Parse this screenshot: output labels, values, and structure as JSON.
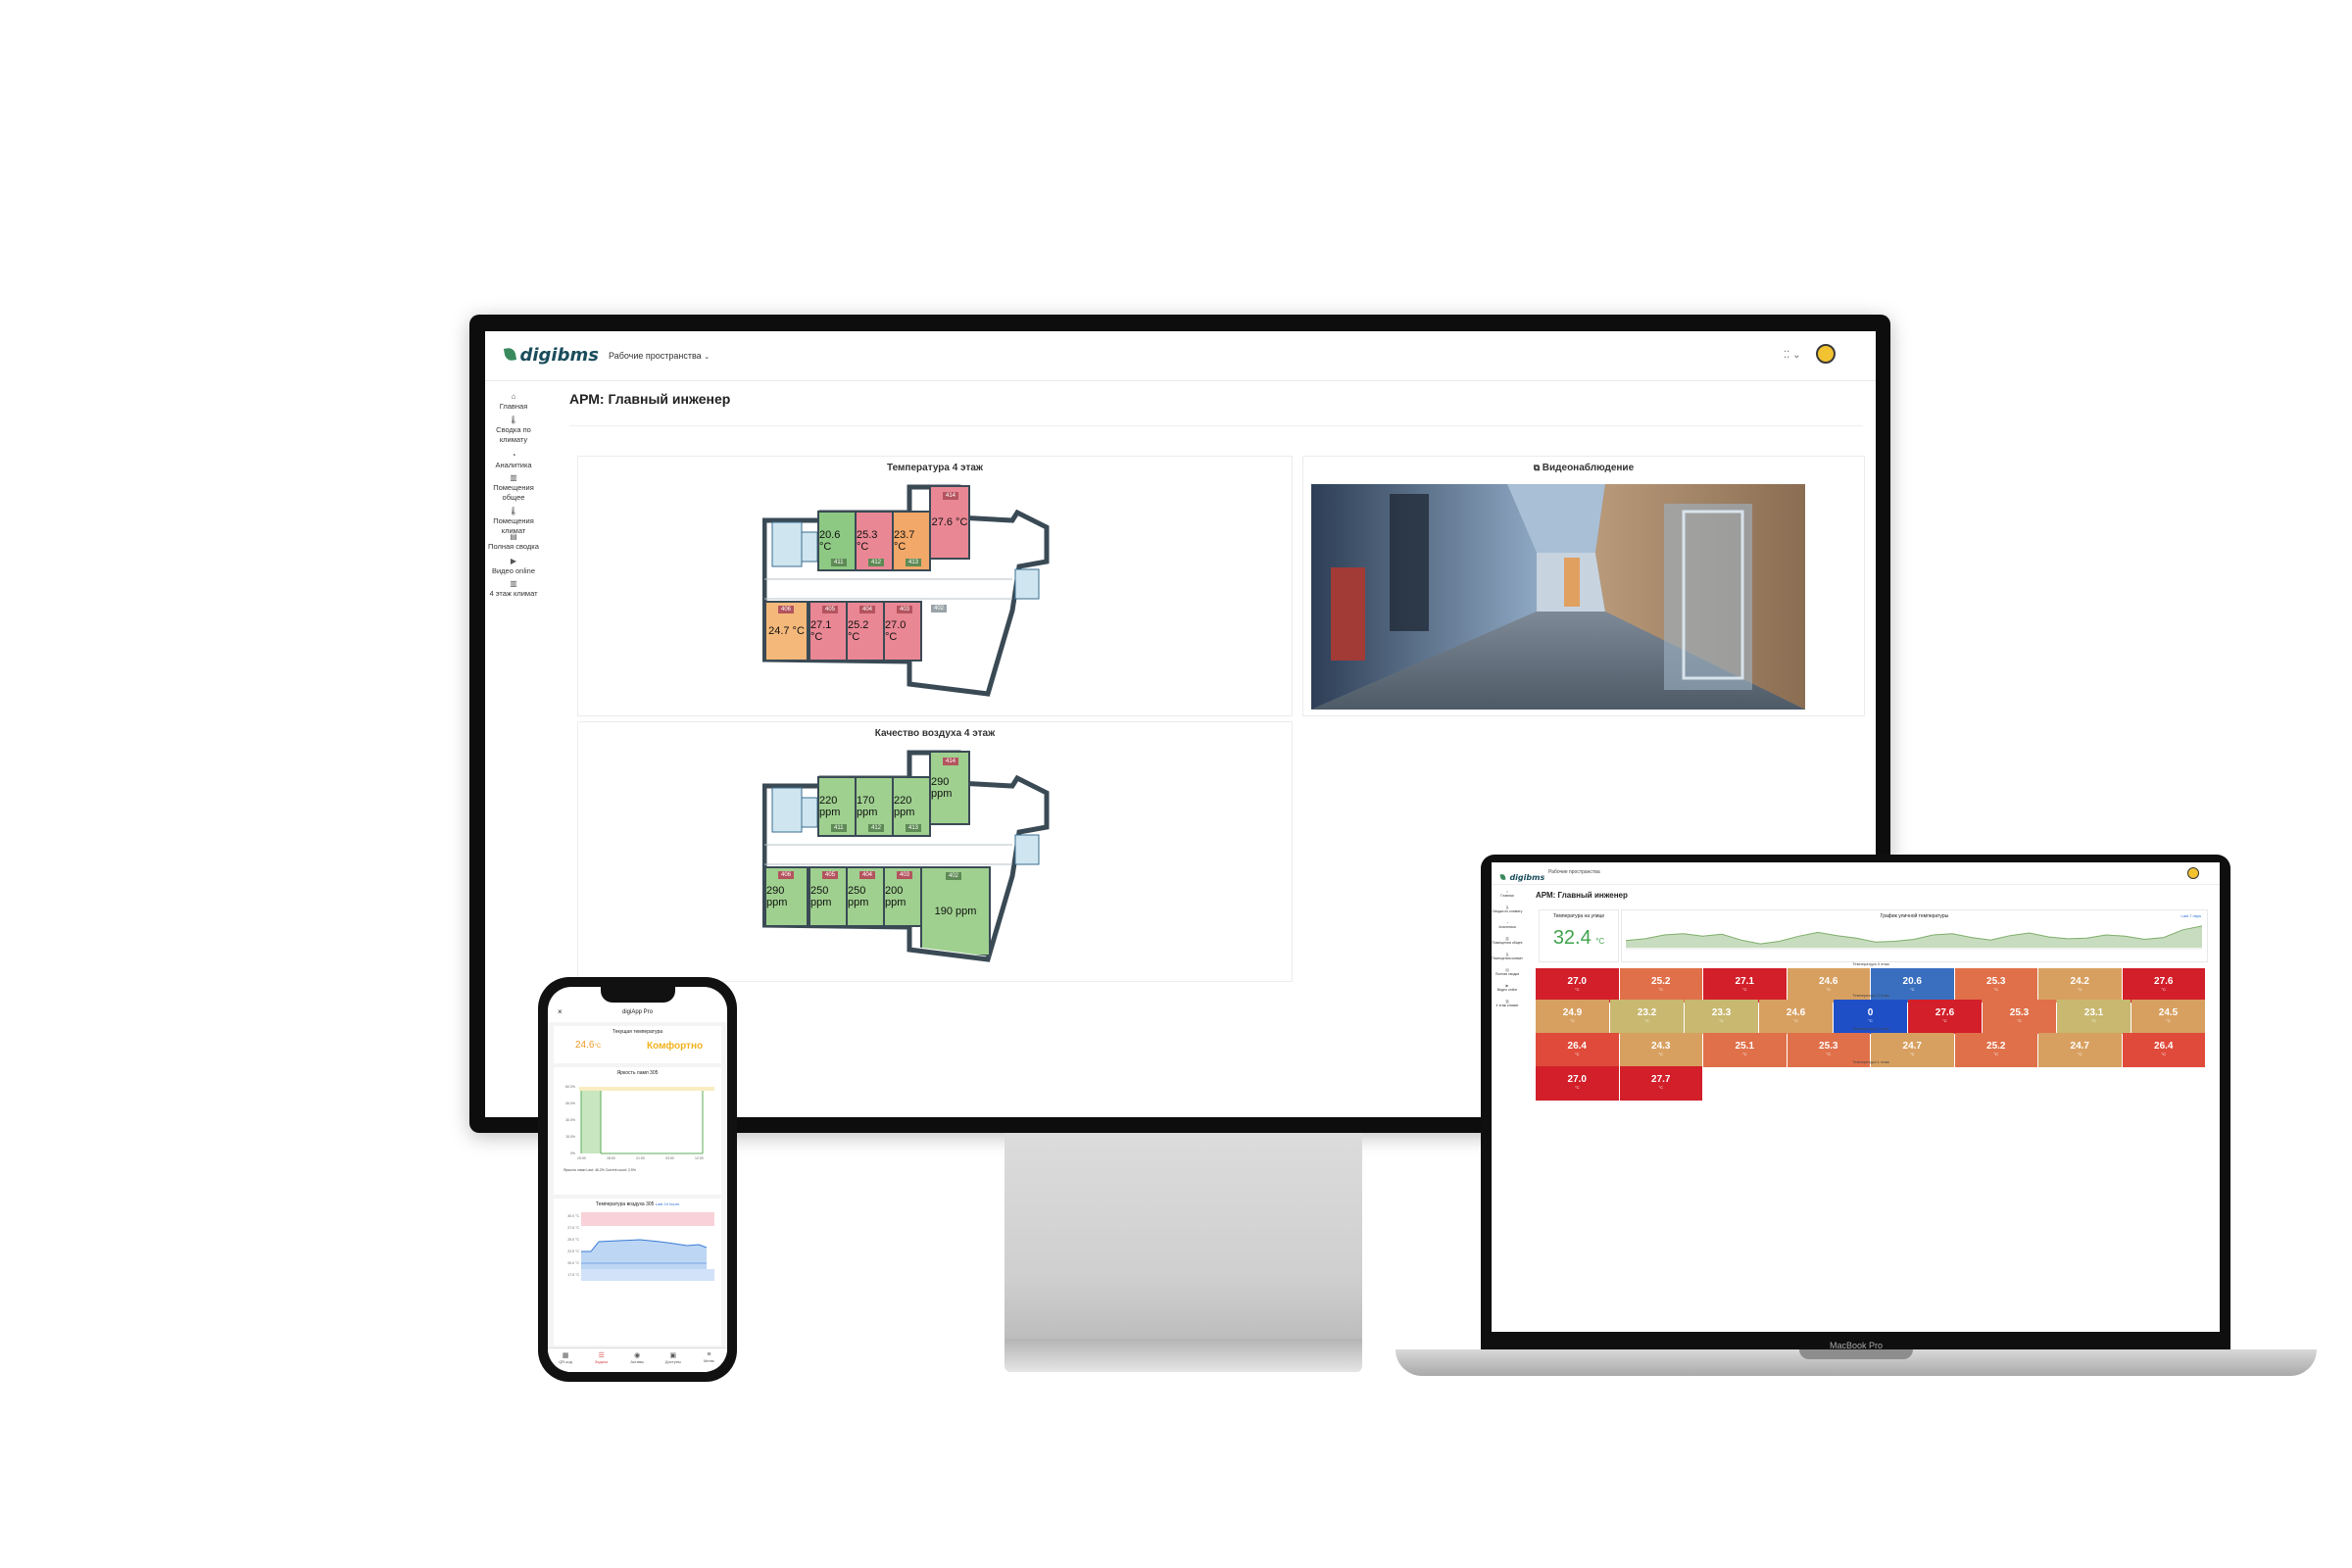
{
  "monitor": {
    "brand": "digibms",
    "workspace_menu": "Рабочие пространства",
    "page_title": "АРМ: Главный инженер",
    "sidebar": [
      {
        "label": "Главная",
        "icon": "home-icon"
      },
      {
        "label": "Сводка по климату",
        "icon": "thermometer-icon"
      },
      {
        "label": "Аналитика",
        "icon": "analytics-icon"
      },
      {
        "label": "Помещения общее",
        "icon": "building-icon"
      },
      {
        "label": "Помещения климат",
        "icon": "thermometer-icon"
      },
      {
        "label": "Полная сводка",
        "icon": "calendar-icon"
      },
      {
        "label": "Видео online",
        "icon": "video-icon"
      },
      {
        "label": "4 этаж климат",
        "icon": "building-icon"
      }
    ],
    "temp_panel": {
      "title": "Температура 4 этаж",
      "rooms_top": [
        {
          "tag": "411",
          "value": "20.6 °C",
          "color": "#8dc983"
        },
        {
          "tag": "412",
          "value": "25.3 °C",
          "color": "#ea8794"
        },
        {
          "tag": "413",
          "value": "23.7 °C",
          "color": "#f2a868"
        }
      ],
      "room_corner": {
        "tag": "414",
        "value": "27.6 °C",
        "color": "#ea8794"
      },
      "rooms_bottom": [
        {
          "tag": "406",
          "value": "24.7 °C",
          "color": "#f4b87a"
        },
        {
          "tag": "405",
          "value": "27.1 °C",
          "color": "#ea8794"
        },
        {
          "tag": "404",
          "value": "25.2 °C",
          "color": "#ea8794"
        },
        {
          "tag": "403",
          "value": "27.0 °C",
          "color": "#ea8794"
        }
      ],
      "corridor_tag": "402"
    },
    "air_panel": {
      "title": "Качество воздуха 4 этаж",
      "rooms_top": [
        {
          "tag": "411",
          "value": "220 ppm"
        },
        {
          "tag": "412",
          "value": "170 ppm"
        },
        {
          "tag": "413",
          "value": "220 ppm"
        }
      ],
      "room_corner": {
        "tag": "414",
        "value": "290 ppm"
      },
      "rooms_bottom": [
        {
          "tag": "406",
          "value": "290 ppm"
        },
        {
          "tag": "405",
          "value": "250 ppm"
        },
        {
          "tag": "404",
          "value": "250 ppm"
        },
        {
          "tag": "403",
          "value": "200 ppm"
        }
      ],
      "corridor": {
        "tag": "402",
        "value": "190 ppm"
      },
      "color": "#9fd08f"
    },
    "video_panel": {
      "title": "Видеонаблюдение"
    }
  },
  "laptop": {
    "brand": "digibms",
    "workspace_menu": "Рабочие пространства",
    "page_title": "АРМ: Главный инженер",
    "model_label": "MacBook Pro",
    "current_temp": {
      "label": "Температура на улице",
      "value": "32.4",
      "unit": "°C"
    },
    "trend_title": "График уличной температуры",
    "trend_link": "Last 7 days",
    "chart_data": {
      "type": "area",
      "series": [
        {
          "values": [
            30.1,
            30.4,
            31.0,
            31.2,
            30.8,
            31.1,
            30.2,
            29.6,
            30.0,
            30.8,
            31.4,
            30.9,
            30.5,
            29.9,
            30.0,
            30.3,
            31.0,
            31.2,
            30.6,
            30.2,
            30.9,
            31.3,
            30.7,
            30.4,
            30.5,
            31.0,
            30.8,
            30.3,
            30.6,
            31.8,
            32.4
          ]
        }
      ]
    },
    "group_titles": [
      "Температура 4 этаж",
      "Температура 3 этаж",
      "Температура 2 этаж",
      "Температура 1 этаж"
    ],
    "row1": [
      {
        "value": "27.0",
        "color": "#d21f2a"
      },
      {
        "value": "25.2",
        "color": "#e0704a"
      },
      {
        "value": "27.1",
        "color": "#d21f2a"
      },
      {
        "value": "24.6",
        "color": "#d8a060"
      },
      {
        "value": "20.6",
        "color": "#3a6fbf"
      },
      {
        "value": "25.3",
        "color": "#e0704a"
      },
      {
        "value": "24.2",
        "color": "#d8a060"
      },
      {
        "value": "27.6",
        "color": "#d21f2a"
      }
    ],
    "row2": [
      {
        "value": "24.9",
        "color": "#d8a060"
      },
      {
        "value": "23.2",
        "color": "#c8b870"
      },
      {
        "value": "23.3",
        "color": "#c8b870"
      },
      {
        "value": "24.6",
        "color": "#d8a060"
      },
      {
        "value": "0",
        "color": "#1f4fc7"
      },
      {
        "value": "27.6",
        "color": "#d21f2a"
      },
      {
        "value": "25.3",
        "color": "#e0704a"
      },
      {
        "value": "23.1",
        "color": "#c8b870"
      },
      {
        "value": "24.5",
        "color": "#d8a060"
      }
    ],
    "row3": [
      {
        "value": "26.4",
        "color": "#e04a3a"
      },
      {
        "value": "24.3",
        "color": "#d8a060"
      },
      {
        "value": "25.1",
        "color": "#e0704a"
      },
      {
        "value": "25.3",
        "color": "#e0704a"
      },
      {
        "value": "24.7",
        "color": "#d8a060"
      },
      {
        "value": "25.2",
        "color": "#e0704a"
      },
      {
        "value": "24.7",
        "color": "#d8a060"
      },
      {
        "value": "26.4",
        "color": "#e04a3a"
      }
    ],
    "row4": [
      {
        "value": "27.0",
        "color": "#d21f2a"
      },
      {
        "value": "27.7",
        "color": "#d21f2a"
      }
    ],
    "unit": "°C"
  },
  "phone": {
    "app_title": "digiApp Pro",
    "current_temp_label": "Текущая температура",
    "current_temp_value": "24.6",
    "current_temp_unit": "°C",
    "comfort_status": "Комфортно",
    "brightness_title": "Яркость ламп 305",
    "brightness_yticks": [
      "60.0%",
      "45.0%",
      "30.0%",
      "15.0%",
      "0%"
    ],
    "brightness_xticks": [
      "15:00",
      "18:00",
      "21:00",
      "03:00",
      "12:00"
    ],
    "brightness_legend": "Яркость ламп   Last: 46.2%   Current count: 2.5%",
    "temp_title": "Температура воздуха 305",
    "temp_link": "Last 24 hours",
    "temp_yticks": [
      "30.0 °C",
      "27.5 °C",
      "25.0 °C",
      "22.5 °C",
      "20.0 °C",
      "17.5 °C"
    ],
    "nav": [
      {
        "label": "QR-код",
        "icon": "grid-icon"
      },
      {
        "label": "Задачи",
        "icon": "tasks-icon"
      },
      {
        "label": "Активы",
        "icon": "assets-icon"
      },
      {
        "label": "Доступы",
        "icon": "access-icon"
      },
      {
        "label": "Меню",
        "icon": "menu-icon"
      }
    ]
  }
}
